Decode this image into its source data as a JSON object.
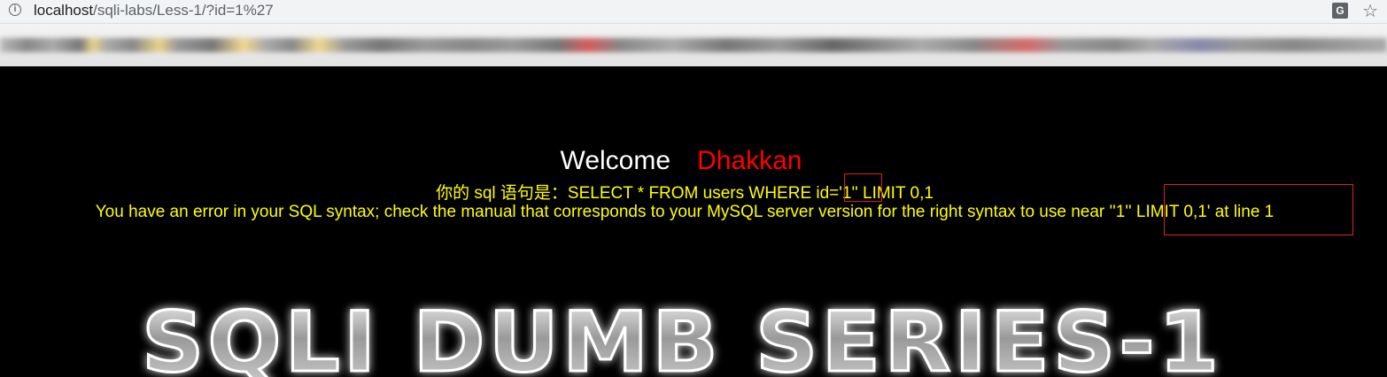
{
  "browser": {
    "url_host": "localhost",
    "url_path": "/sqli-labs/Less-1/?id=1%27",
    "info_icon": "info-icon",
    "translate_icon": "translate-icon",
    "star_icon": "star-icon"
  },
  "page": {
    "welcome": "Welcome",
    "name": "Dhakkan",
    "query_label": "你的 sql 语句是：",
    "query_text": "SELECT * FROM users WHERE id='1'' LIMIT 0,1",
    "error_text": "You have an error in your SQL syntax; check the manual that corresponds to your MySQL server version for the right syntax to use near ''1'' LIMIT 0,1' at line 1",
    "banner_text": "SQLI DUMB SERIES-1",
    "colors": {
      "welcome": "#ffffff",
      "name": "#ff0000",
      "query": "#ffff00",
      "error": "#ffff00",
      "highlight_box": "#d9241c"
    }
  }
}
